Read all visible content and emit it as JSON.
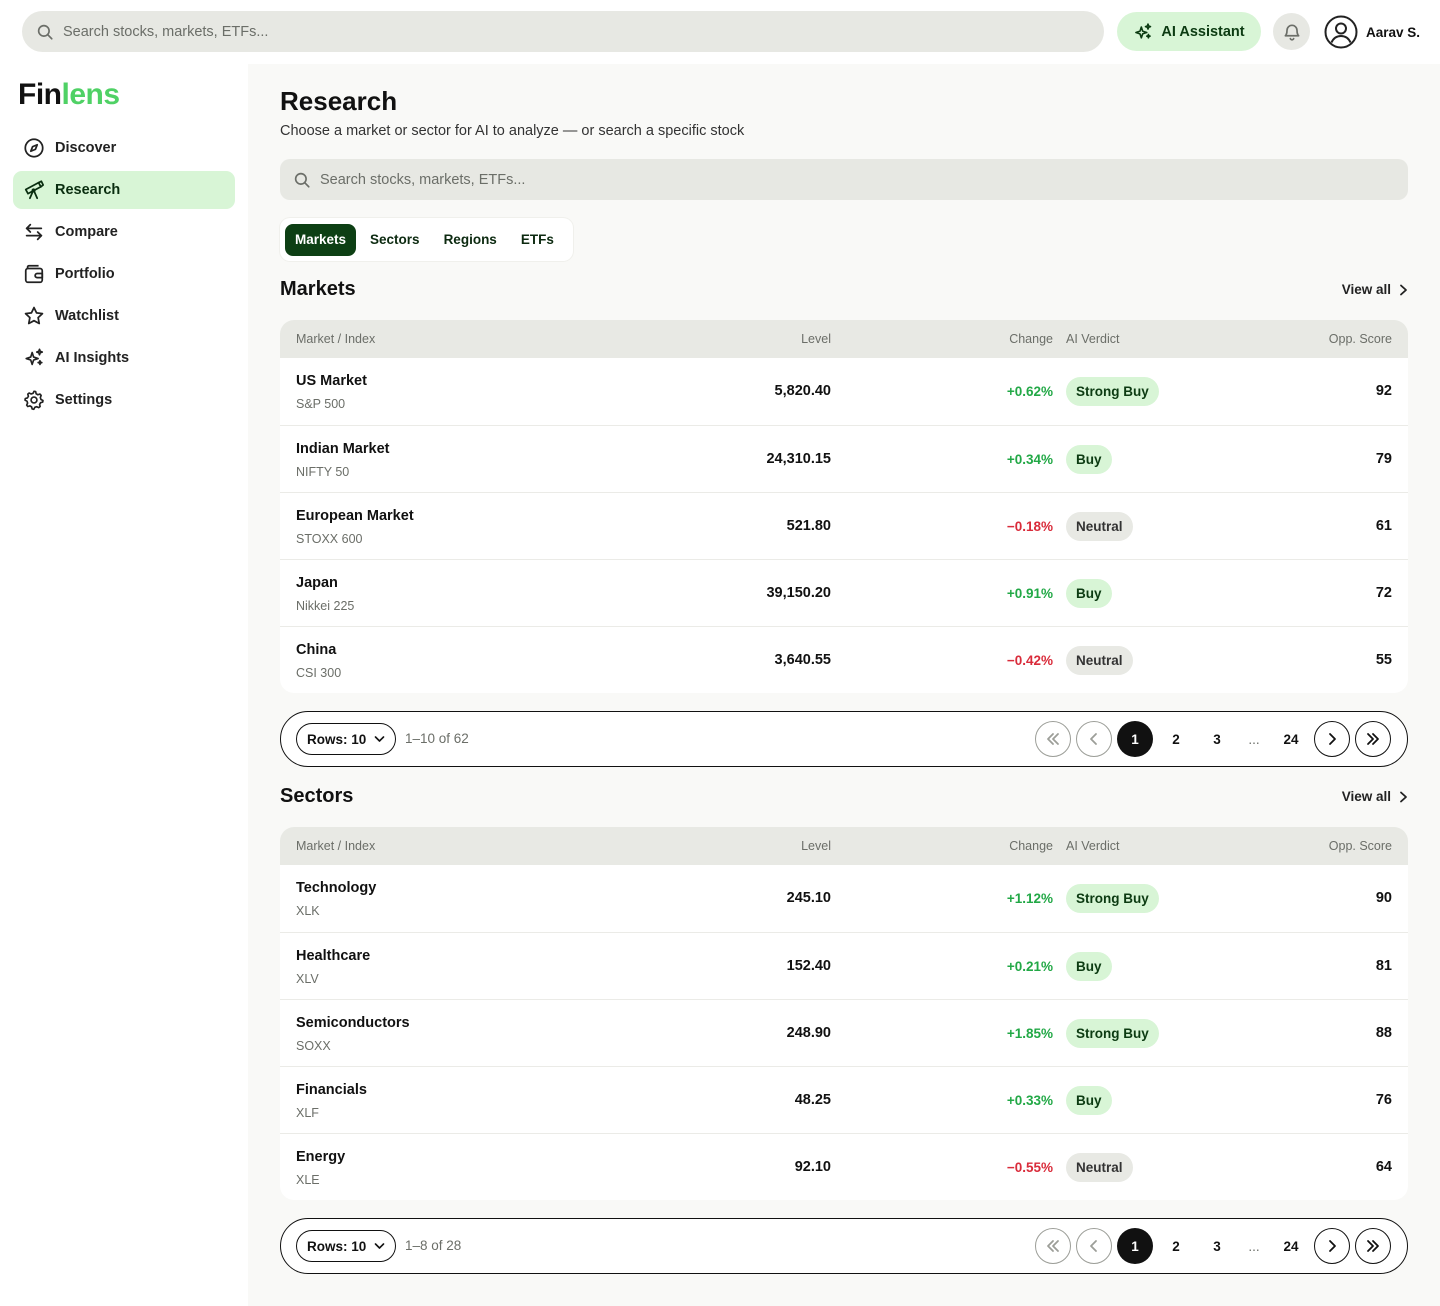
{
  "topbar": {
    "search_placeholder": "Search stocks, markets, ETFs...",
    "ai_button_label": "AI Assistant",
    "user_name": "Aarav S."
  },
  "brand": {
    "part1": "Fin",
    "part2": "lens",
    "accent_color": "#4fd165"
  },
  "sidebar": {
    "items": [
      {
        "label": "Discover",
        "icon": "compass-icon",
        "active": false
      },
      {
        "label": "Research",
        "icon": "telescope-icon",
        "active": true
      },
      {
        "label": "Compare",
        "icon": "arrows-swap-icon",
        "active": false
      },
      {
        "label": "Portfolio",
        "icon": "wallet-icon",
        "active": false
      },
      {
        "label": "Watchlist",
        "icon": "star-icon",
        "active": false
      },
      {
        "label": "AI Insights",
        "icon": "sparkle-icon",
        "active": false
      },
      {
        "label": "Settings",
        "icon": "gear-icon",
        "active": false
      }
    ]
  },
  "page": {
    "title": "Research",
    "subtitle": "Choose a market or sector for AI to analyze — or search a specific stock",
    "search_placeholder": "Search stocks, markets, ETFs...",
    "tabs": [
      {
        "label": "Markets",
        "active": true
      },
      {
        "label": "Sectors",
        "active": false
      },
      {
        "label": "Regions",
        "active": false
      },
      {
        "label": "ETFs",
        "active": false
      }
    ]
  },
  "columns": {
    "name": "Market / Index",
    "level": "Level",
    "change": "Change",
    "verdict": "AI Verdict",
    "score": "Opp. Score"
  },
  "markets": {
    "title": "Markets",
    "view_all": "View all",
    "rows": [
      {
        "name": "US Market",
        "sub": "S&P 500",
        "level": "5,820.40",
        "change": "+0.62%",
        "dir": "up",
        "verdict": "Strong Buy",
        "verdict_type": "strong",
        "score": "92"
      },
      {
        "name": "Indian Market",
        "sub": "NIFTY 50",
        "level": "24,310.15",
        "change": "+0.34%",
        "dir": "up",
        "verdict": "Buy",
        "verdict_type": "buy",
        "score": "79"
      },
      {
        "name": "European Market",
        "sub": "STOXX 600",
        "level": "521.80",
        "change": "−0.18%",
        "dir": "down",
        "verdict": "Neutral",
        "verdict_type": "neutral",
        "score": "61"
      },
      {
        "name": "Japan",
        "sub": "Nikkei 225",
        "level": "39,150.20",
        "change": "+0.91%",
        "dir": "up",
        "verdict": "Buy",
        "verdict_type": "buy",
        "score": "72"
      },
      {
        "name": "China",
        "sub": "CSI 300",
        "level": "3,640.55",
        "change": "−0.42%",
        "dir": "down",
        "verdict": "Neutral",
        "verdict_type": "neutral",
        "score": "55"
      }
    ],
    "pager": {
      "rows_label": "Rows: 10",
      "range": "1–10 of 62",
      "pages": [
        "1",
        "2",
        "3",
        "...",
        "24"
      ]
    }
  },
  "sectors": {
    "title": "Sectors",
    "view_all": "View all",
    "rows": [
      {
        "name": "Technology",
        "sub": "XLK",
        "level": "245.10",
        "change": "+1.12%",
        "dir": "up",
        "verdict": "Strong Buy",
        "verdict_type": "strong",
        "score": "90"
      },
      {
        "name": "Healthcare",
        "sub": "XLV",
        "level": "152.40",
        "change": "+0.21%",
        "dir": "up",
        "verdict": "Buy",
        "verdict_type": "buy",
        "score": "81"
      },
      {
        "name": "Semiconductors",
        "sub": "SOXX",
        "level": "248.90",
        "change": "+1.85%",
        "dir": "up",
        "verdict": "Strong Buy",
        "verdict_type": "strong",
        "score": "88"
      },
      {
        "name": "Financials",
        "sub": "XLF",
        "level": "48.25",
        "change": "+0.33%",
        "dir": "up",
        "verdict": "Buy",
        "verdict_type": "buy",
        "score": "76"
      },
      {
        "name": "Energy",
        "sub": "XLE",
        "level": "92.10",
        "change": "−0.55%",
        "dir": "down",
        "verdict": "Neutral",
        "verdict_type": "neutral",
        "score": "64"
      }
    ],
    "pager": {
      "rows_label": "Rows: 10",
      "range": "1–8 of 28",
      "pages": [
        "1",
        "2",
        "3",
        "...",
        "24"
      ]
    }
  }
}
